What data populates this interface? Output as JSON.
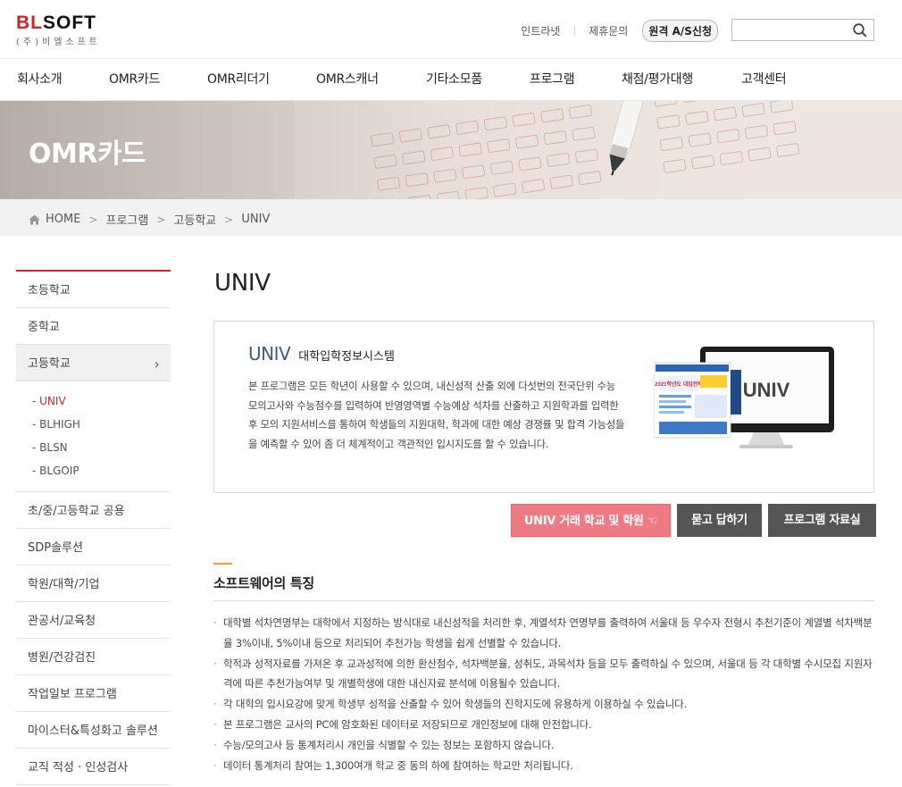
{
  "brand": {
    "logo_main": "BLSOFT",
    "logo_sub": "(주)비엘소프트"
  },
  "util": {
    "intranet": "인트라넷",
    "partnership": "제휴문의",
    "remote_as": "원격 A/S신청",
    "search_placeholder": ""
  },
  "gnb": [
    "회사소개",
    "OMR카드",
    "OMR리더기",
    "OMR스캐너",
    "기타소모품",
    "프로그램",
    "채점/평가대행",
    "고객센터"
  ],
  "banner": {
    "title": "OMR카드"
  },
  "breadcrumb": {
    "home": "HOME",
    "items": [
      "프로그램",
      "고등학교",
      "UNIV"
    ],
    "separator": ">"
  },
  "sidebar": {
    "items": [
      "초등학교",
      "중학교",
      "고등학교",
      "초/중/고등학교 공용",
      "SDP솔루션",
      "학원/대학/기업",
      "관공서/교육청",
      "병원/건강검진",
      "작업일보 프로그램",
      "마이스터&특성화고 솔루션",
      "교직 적성 · 인성검사"
    ],
    "active_index": 2,
    "sub_items": [
      "- UNIV",
      "- BLHIGH",
      "- BLSN",
      "- BLGOIP"
    ],
    "sub_active_index": 0
  },
  "main": {
    "title": "UNIV",
    "product_name": "UNIV",
    "product_desc": "대학입학정보시스템",
    "intro": "본 프로그램은 모든 학년이 사용할 수 있으며, 내신성적 산출 외에 다섯번의 전국단위 수능 모의고사와 수능점수를 입력하여 반영영역별 수능예상 석차를 산출하고 지원학과를 입력한 후 모의 지원서비스를 통하여 학생들의 지원대학, 학과에 대한 예상 경쟁률 및 합격 가능성들을 예측할 수 있어 좀 더 체계적이고 객관적인 입시지도를 할 수 있습니다.",
    "monitor_label": "UNIV",
    "brochure_label": "2021학년도 대입전략",
    "buttons": {
      "schools": "UNIV 거래 학교 및 학원 ☜",
      "qna": "묻고 답하기",
      "library": "프로그램 자료실"
    },
    "features_title": "소프트웨어의 특징",
    "features": [
      "대학별 석차연명부는 대학에서 지정하는 방식대로 내신성적을 처리한 후, 계열석차 연명부를 출력하여 서울대 등 우수자 전형시 추천기준이 계열별 석차백분율 3%이내, 5%이내 등으로 처리되어 추천가능 학생을 쉽게 선별할 수 있습니다.",
      "학적과 성적자료를 가져온 후 교과성적에 의한 환산점수, 석차백분율, 성취도, 과목석차 등을 모두 출력하실 수 있으며, 서울대 등 각 대학별 수시모집 지원자격에 따른 추천가능여부 및 개별학생에 대한 내신자료 분석에 이용될수 있습니다.",
      "각 대학의 입시요강에 맞게 학생부 성적을 산출할 수 있어 학생들의 진학지도에 유용하게 이용하실 수 있습니다.",
      "본 프로그램은 교사의 PC에 암호화된 데이터로 저장되므로 개인정보에 대해 안전합니다.",
      "수능/모의고사 등 통계처리시 개인을 식별할 수 있는 정보는 포함하지 않습니다.",
      "데이터 통계처리 참여는 1,300여개 학교 중 동의 하에 참여하는 학교만 처리됩니다."
    ]
  },
  "icons": {
    "search": "search-icon",
    "home": "home-icon",
    "arrow": "chevron-right-icon"
  },
  "colors": {
    "accent_red": "#d3252d",
    "button_pink": "#ee7b83",
    "button_gray": "#555555",
    "product_blue": "#3f5c80",
    "feature_bar": "#f39c20"
  }
}
